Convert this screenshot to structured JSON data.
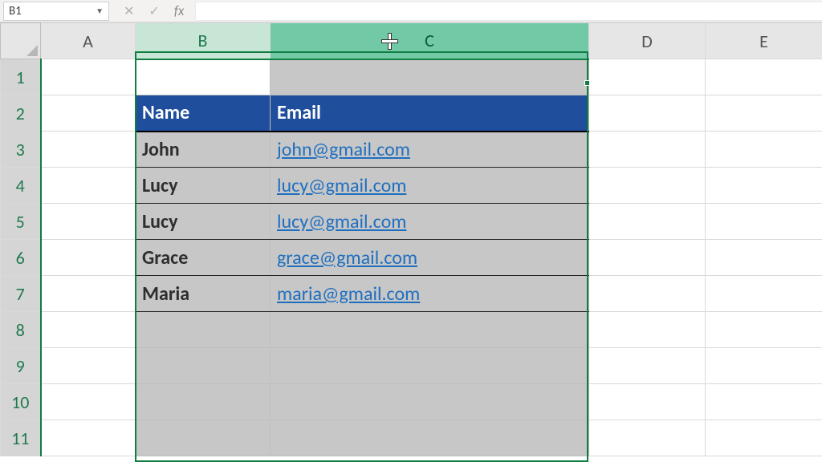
{
  "name_box": "B1",
  "fx_symbol": "fx",
  "columns": [
    "A",
    "B",
    "C",
    "D",
    "E"
  ],
  "rows": [
    "1",
    "2",
    "3",
    "4",
    "5",
    "6",
    "7",
    "8",
    "9",
    "10",
    "11"
  ],
  "table": {
    "header": {
      "name": "Name",
      "email": "Email"
    },
    "rows": [
      {
        "name": "John",
        "email": "john@gmail.com"
      },
      {
        "name": "Lucy",
        "email": "lucy@gmail.com"
      },
      {
        "name": "Lucy",
        "email": "lucy@gmail.com"
      },
      {
        "name": "Grace",
        "email": "grace@gmail.com"
      },
      {
        "name": "Maria",
        "email": "maria@gmail.com"
      }
    ]
  },
  "selection": {
    "active_cell": "B1",
    "columns": [
      "B",
      "C"
    ]
  }
}
